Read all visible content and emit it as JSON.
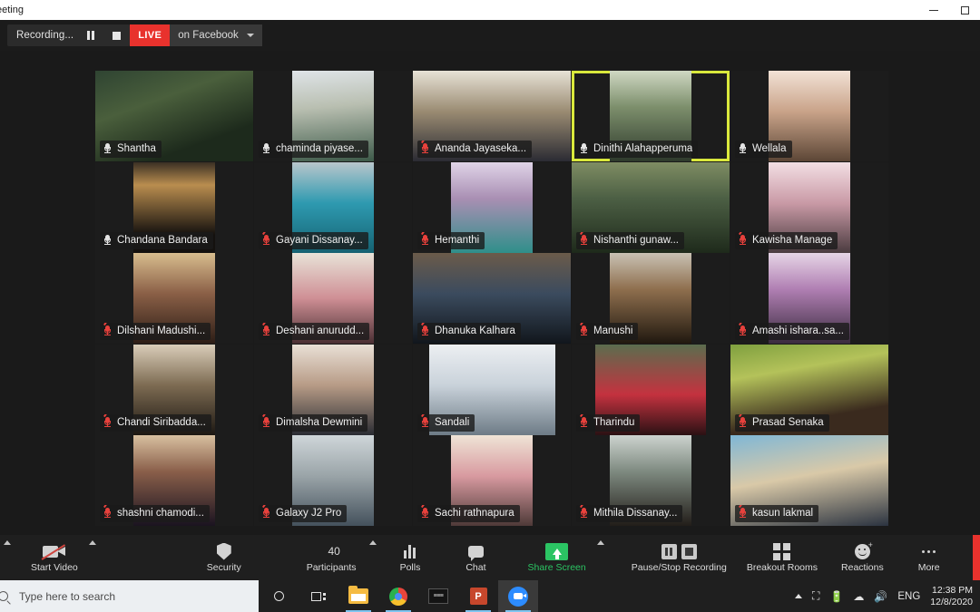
{
  "window": {
    "title": "eeting",
    "minimize_label": "Minimize",
    "restore_label": "Restore"
  },
  "recording_bar": {
    "status_text": "Recording...",
    "pause_label": "Pause Recording",
    "stop_label": "Stop Recording",
    "live_badge": "LIVE",
    "live_destination": "on Facebook"
  },
  "gallery": {
    "active_speaker": "Dinithi Alahapperuma",
    "tiles": [
      {
        "name": "Shantha",
        "muted": false,
        "row": 0,
        "col": 0
      },
      {
        "name": "chaminda piyase...",
        "muted": false,
        "row": 0,
        "col": 1
      },
      {
        "name": "Ananda Jayaseka...",
        "muted": true,
        "row": 0,
        "col": 2
      },
      {
        "name": "Dinithi Alahapperuma",
        "muted": false,
        "row": 0,
        "col": 3,
        "active": true
      },
      {
        "name": "Wellala",
        "muted": false,
        "row": 0,
        "col": 4
      },
      {
        "name": "Chandana Bandara",
        "muted": false,
        "row": 1,
        "col": 0
      },
      {
        "name": "Gayani Dissanay...",
        "muted": true,
        "row": 1,
        "col": 1
      },
      {
        "name": "Hemanthi",
        "muted": true,
        "row": 1,
        "col": 2
      },
      {
        "name": "Nishanthi gunaw...",
        "muted": true,
        "row": 1,
        "col": 3
      },
      {
        "name": "Kawisha Manage",
        "muted": true,
        "row": 1,
        "col": 4
      },
      {
        "name": "Dilshani Madushi...",
        "muted": true,
        "row": 2,
        "col": 0
      },
      {
        "name": "Deshani anurudd...",
        "muted": true,
        "row": 2,
        "col": 1
      },
      {
        "name": "Dhanuka Kalhara",
        "muted": true,
        "row": 2,
        "col": 2
      },
      {
        "name": "Manushi",
        "muted": true,
        "row": 2,
        "col": 3
      },
      {
        "name": "Amashi ishara..sa...",
        "muted": true,
        "row": 2,
        "col": 4
      },
      {
        "name": "Chandi Siribadda...",
        "muted": true,
        "row": 3,
        "col": 0
      },
      {
        "name": "Dimalsha Dewmini",
        "muted": true,
        "row": 3,
        "col": 1
      },
      {
        "name": "Sandali",
        "muted": true,
        "row": 3,
        "col": 2
      },
      {
        "name": "Tharindu",
        "muted": true,
        "row": 3,
        "col": 3
      },
      {
        "name": "Prasad Senaka",
        "muted": true,
        "row": 3,
        "col": 4
      },
      {
        "name": "shashni chamodi...",
        "muted": true,
        "row": 4,
        "col": 0
      },
      {
        "name": "Galaxy J2 Pro",
        "muted": true,
        "row": 4,
        "col": 1
      },
      {
        "name": "Sachi rathnapura",
        "muted": true,
        "row": 4,
        "col": 2
      },
      {
        "name": "Mithila Dissanay...",
        "muted": true,
        "row": 4,
        "col": 3
      },
      {
        "name": "kasun lakmal",
        "muted": true,
        "row": 4,
        "col": 4
      }
    ]
  },
  "toolbar": {
    "start_video": "Start Video",
    "security": "Security",
    "participants": "Participants",
    "participants_count": "40",
    "polls": "Polls",
    "chat": "Chat",
    "share_screen": "Share Screen",
    "share_screen_color": "#2bc463",
    "pause_stop_recording": "Pause/Stop Recording",
    "breakout_rooms": "Breakout Rooms",
    "reactions": "Reactions",
    "more": "More",
    "end_color": "#e8322d"
  },
  "taskbar": {
    "search_placeholder": "Type here to search",
    "apps": [
      {
        "name": "cortana"
      },
      {
        "name": "task-view"
      },
      {
        "name": "file-explorer"
      },
      {
        "name": "google-chrome"
      },
      {
        "name": "dark-app"
      },
      {
        "name": "powerpoint"
      },
      {
        "name": "zoom"
      }
    ],
    "tray": {
      "language": "ENG",
      "time": "12:38 PM",
      "date": "12/8/2020"
    }
  }
}
